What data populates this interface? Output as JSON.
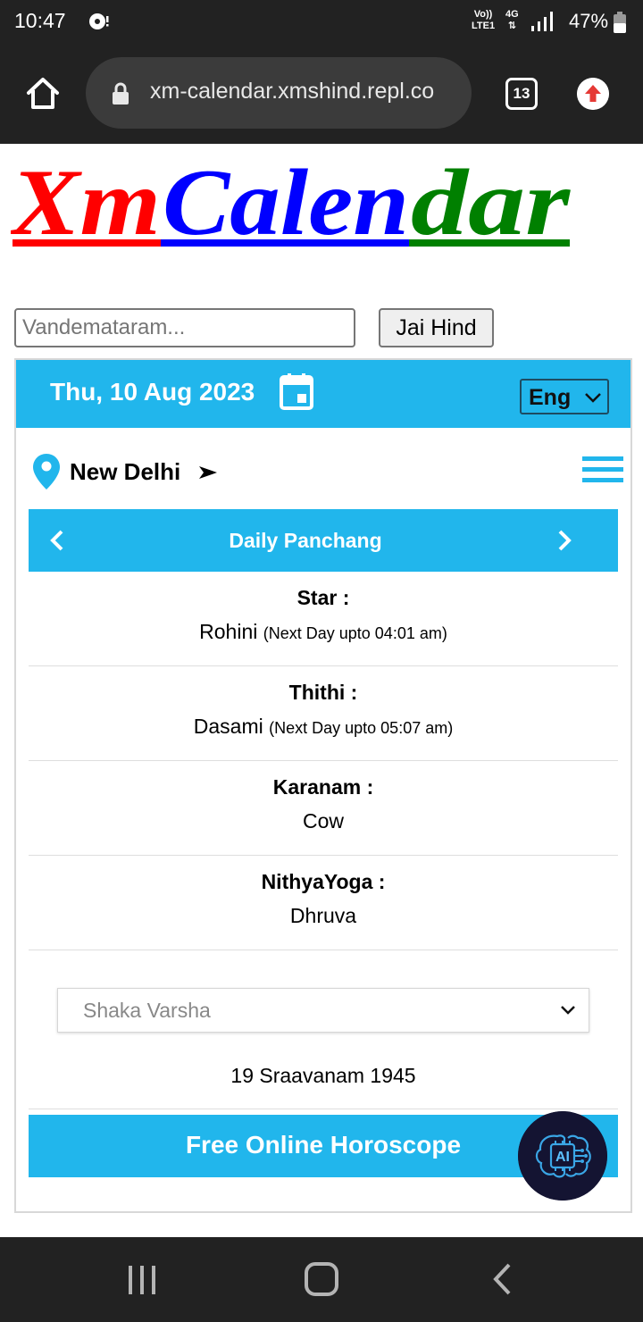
{
  "status_bar": {
    "time": "10:47",
    "network": "Vo)) LTE1",
    "network_line1": "Vo))",
    "network_line2": "LTE1",
    "mobile_data": "4G",
    "battery": "47%"
  },
  "browser": {
    "url": "xm-calendar.xmshind.repl.co",
    "tab_count": "13"
  },
  "logo": {
    "parts": [
      "Xm",
      "Calen",
      "dar"
    ],
    "colors": [
      "#ff0000",
      "#0000ff",
      "#008000"
    ]
  },
  "search": {
    "placeholder": "Vandemataram...",
    "value": "",
    "button_label": "Jai Hind"
  },
  "header": {
    "date": "Thu, 10 Aug 2023",
    "language": "Eng"
  },
  "location": {
    "city": "New Delhi"
  },
  "panchang": {
    "title": "Daily Panchang",
    "items": [
      {
        "label": "Star :",
        "value": "Rohini",
        "note": "(Next Day upto 04:01 am)"
      },
      {
        "label": "Thithi :",
        "value": "Dasami",
        "note": "(Next Day upto 05:07 am)"
      },
      {
        "label": "Karanam :",
        "value": "Cow",
        "note": ""
      },
      {
        "label": "NithyaYoga :",
        "value": "Dhruva",
        "note": ""
      }
    ]
  },
  "era": {
    "selected": "Shaka Varsha",
    "date": "19 Sraavanam 1945"
  },
  "horoscope": {
    "label": "Free Online Horoscope"
  },
  "ai_button": {
    "label": "AI"
  },
  "colors": {
    "accent": "#21b6ec",
    "status_bar": "#222222"
  },
  "icons": [
    "home-icon",
    "lock-icon",
    "tabs-icon",
    "upload-icon",
    "calendar-icon",
    "location-pin-icon",
    "menu-icon",
    "chevron-left-icon",
    "chevron-right-icon",
    "chevron-down-icon",
    "ai-chip-icon"
  ]
}
